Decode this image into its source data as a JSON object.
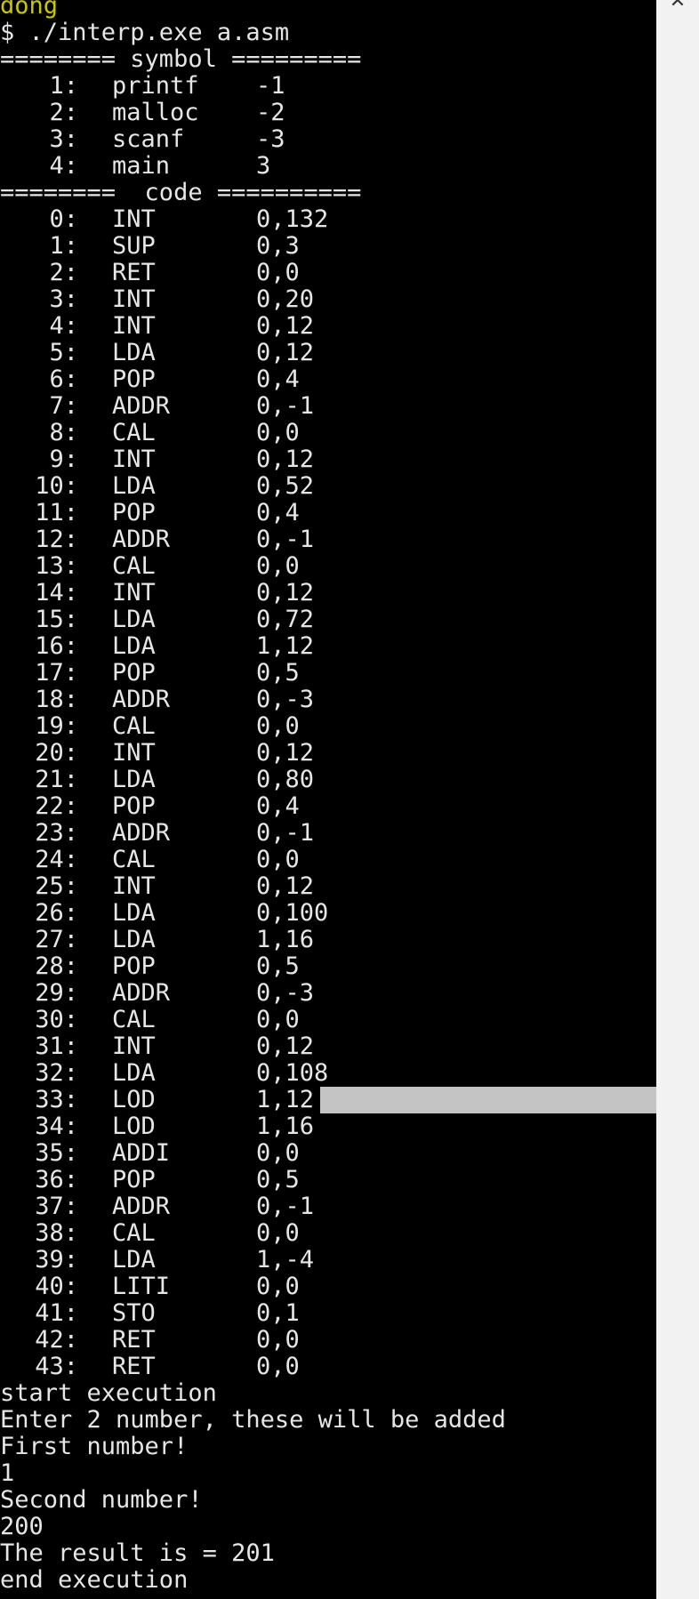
{
  "terminal": {
    "user_line": "dong",
    "command": "$ ./interp.exe a.asm",
    "symbol_header": "======== symbol =========",
    "symbols": [
      {
        "index": "1:",
        "name": "printf",
        "value": "-1"
      },
      {
        "index": "2:",
        "name": "malloc",
        "value": "-2"
      },
      {
        "index": "3:",
        "name": "scanf",
        "value": "-3"
      },
      {
        "index": "4:",
        "name": "main",
        "value": "3"
      }
    ],
    "code_header": "========  code ==========",
    "code": [
      {
        "index": "0:",
        "op": "INT",
        "arg": "0,132"
      },
      {
        "index": "1:",
        "op": "SUP",
        "arg": "0,3"
      },
      {
        "index": "2:",
        "op": "RET",
        "arg": "0,0"
      },
      {
        "index": "3:",
        "op": "INT",
        "arg": "0,20"
      },
      {
        "index": "4:",
        "op": "INT",
        "arg": "0,12"
      },
      {
        "index": "5:",
        "op": "LDA",
        "arg": "0,12"
      },
      {
        "index": "6:",
        "op": "POP",
        "arg": "0,4"
      },
      {
        "index": "7:",
        "op": "ADDR",
        "arg": "0,-1"
      },
      {
        "index": "8:",
        "op": "CAL",
        "arg": "0,0"
      },
      {
        "index": "9:",
        "op": "INT",
        "arg": "0,12"
      },
      {
        "index": "10:",
        "op": "LDA",
        "arg": "0,52"
      },
      {
        "index": "11:",
        "op": "POP",
        "arg": "0,4"
      },
      {
        "index": "12:",
        "op": "ADDR",
        "arg": "0,-1"
      },
      {
        "index": "13:",
        "op": "CAL",
        "arg": "0,0"
      },
      {
        "index": "14:",
        "op": "INT",
        "arg": "0,12"
      },
      {
        "index": "15:",
        "op": "LDA",
        "arg": "0,72"
      },
      {
        "index": "16:",
        "op": "LDA",
        "arg": "1,12"
      },
      {
        "index": "17:",
        "op": "POP",
        "arg": "0,5"
      },
      {
        "index": "18:",
        "op": "ADDR",
        "arg": "0,-3"
      },
      {
        "index": "19:",
        "op": "CAL",
        "arg": "0,0"
      },
      {
        "index": "20:",
        "op": "INT",
        "arg": "0,12"
      },
      {
        "index": "21:",
        "op": "LDA",
        "arg": "0,80"
      },
      {
        "index": "22:",
        "op": "POP",
        "arg": "0,4"
      },
      {
        "index": "23:",
        "op": "ADDR",
        "arg": "0,-1"
      },
      {
        "index": "24:",
        "op": "CAL",
        "arg": "0,0"
      },
      {
        "index": "25:",
        "op": "INT",
        "arg": "0,12"
      },
      {
        "index": "26:",
        "op": "LDA",
        "arg": "0,100"
      },
      {
        "index": "27:",
        "op": "LDA",
        "arg": "1,16"
      },
      {
        "index": "28:",
        "op": "POP",
        "arg": "0,5"
      },
      {
        "index": "29:",
        "op": "ADDR",
        "arg": "0,-3"
      },
      {
        "index": "30:",
        "op": "CAL",
        "arg": "0,0"
      },
      {
        "index": "31:",
        "op": "INT",
        "arg": "0,12"
      },
      {
        "index": "32:",
        "op": "LDA",
        "arg": "0,108"
      },
      {
        "index": "33:",
        "op": "LOD",
        "arg": "1,12",
        "selected": true
      },
      {
        "index": "34:",
        "op": "LOD",
        "arg": "1,16"
      },
      {
        "index": "35:",
        "op": "ADDI",
        "arg": "0,0"
      },
      {
        "index": "36:",
        "op": "POP",
        "arg": "0,5"
      },
      {
        "index": "37:",
        "op": "ADDR",
        "arg": "0,-1"
      },
      {
        "index": "38:",
        "op": "CAL",
        "arg": "0,0"
      },
      {
        "index": "39:",
        "op": "LDA",
        "arg": "1,-4"
      },
      {
        "index": "40:",
        "op": "LITI",
        "arg": "0,0"
      },
      {
        "index": "41:",
        "op": "STO",
        "arg": "0,1"
      },
      {
        "index": "42:",
        "op": "RET",
        "arg": "0,0"
      },
      {
        "index": "43:",
        "op": "RET",
        "arg": "0,0"
      }
    ],
    "output": [
      "start execution",
      "Enter 2 number, these will be added",
      "First number!",
      "1",
      "Second number!",
      "200",
      "The result is = 201",
      "end execution"
    ]
  },
  "window": {
    "close_glyph": "✕"
  },
  "colors": {
    "background": "#000000",
    "text": "#e6e6e6",
    "user_line": "#c8c800",
    "selection": "#c4c4c4",
    "scrollbar": "#f2f2f2"
  }
}
